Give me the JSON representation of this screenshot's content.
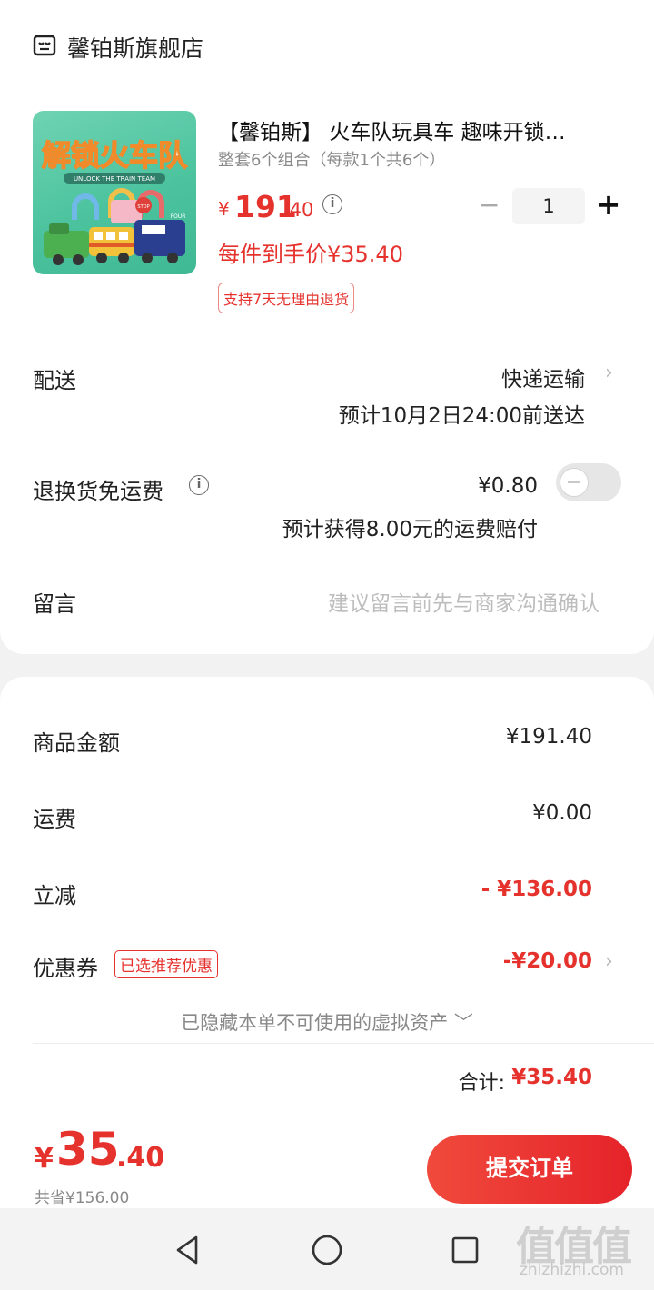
{
  "store": {
    "name": "馨铂斯旗舰店",
    "icon": "store-icon"
  },
  "product": {
    "title": "【馨铂斯】 火车队玩具车 趣味开锁…",
    "spec": "整套6个组合（每款1个共6个）",
    "price_currency": "¥",
    "price_main": "191",
    "price_decimal": ".40",
    "unit_price": "每件到手价¥35.40",
    "return_badge": "支持7天无理由退货",
    "quantity": "1",
    "qty_minus": "−",
    "qty_plus": "+",
    "image": {
      "title": "解锁火车队",
      "subtitle": "UNLOCK THE TRAIN TEAM",
      "sign_text": "STOP",
      "bus_text": "FOUR"
    }
  },
  "delivery": {
    "label": "配送",
    "method": "快递运输",
    "eta": "预计10月2日24:00前送达"
  },
  "return_insurance": {
    "label": "退换货免运费",
    "price": "¥0.80",
    "compensation": "预计获得8.00元的运费赔付",
    "toggle_on": false
  },
  "message": {
    "label": "留言",
    "placeholder": "建议留言前先与商家沟通确认"
  },
  "summary": {
    "goods_label": "商品金额",
    "goods_value": "¥191.40",
    "shipping_label": "运费",
    "shipping_value": "¥0.00",
    "discount_label": "立减",
    "discount_value": "- ¥136.00",
    "coupon_label": "优惠券",
    "coupon_tag": "已选推荐优惠",
    "coupon_value": "-¥20.00",
    "hidden_assets": "已隐藏本单不可使用的虚拟资产 ﹀",
    "total_label": "合计:",
    "total_value": "¥35.40"
  },
  "bottom": {
    "currency": "¥",
    "price_main": "35",
    "price_decimal": ".40",
    "saved": "共省¥156.00",
    "submit_label": "提交订单"
  },
  "watermark": {
    "glyphs": "值值值",
    "domain": "zhizhizhi.com"
  },
  "colors": {
    "accent": "#e5322d",
    "background": "#f2f2f2"
  }
}
